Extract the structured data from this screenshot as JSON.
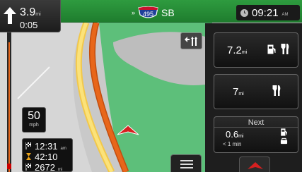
{
  "turn": {
    "distance": "3.9",
    "distance_unit": "mi",
    "time": "0:05"
  },
  "road": {
    "prefix": "»",
    "shield_number": "495",
    "direction": "SB"
  },
  "clock": {
    "time": "09:21",
    "ampm": "AM"
  },
  "poi_cards": [
    {
      "distance": "7.2",
      "unit": "mi",
      "icons": [
        "fuel-pump-icon",
        "restaurant-icon"
      ]
    },
    {
      "distance": "7",
      "unit": "mi",
      "icons": [
        "restaurant-icon"
      ]
    }
  ],
  "next_card": {
    "title": "Next",
    "distance": "0.6",
    "unit": "mi",
    "time": "< 1 min",
    "icons": [
      "fuel-pump-icon",
      "car-icon"
    ]
  },
  "speed": {
    "value": "50",
    "unit": "mph"
  },
  "trip": [
    {
      "value": "12:31",
      "unit": "am"
    },
    {
      "value": "42:10",
      "unit": ""
    },
    {
      "value": "2672",
      "unit": "mi"
    }
  ],
  "colors": {
    "header_green": "#2e9b3f",
    "route_orange": "#e8661a",
    "map_green": "#5dbf7a",
    "panel_dark": "#1e1e1e"
  }
}
